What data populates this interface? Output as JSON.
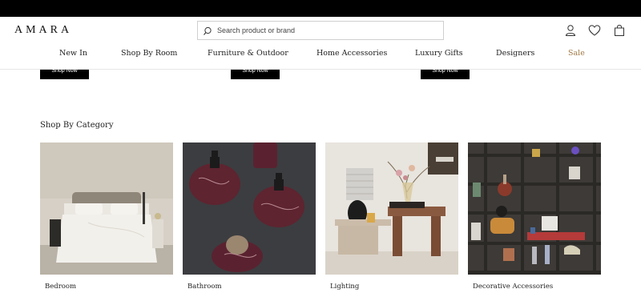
{
  "brand": {
    "name": "AMARA"
  },
  "search": {
    "placeholder": "Search product or brand"
  },
  "nav": {
    "items": [
      {
        "label": "New In"
      },
      {
        "label": "Shop By Room"
      },
      {
        "label": "Furniture & Outdoor"
      },
      {
        "label": "Home Accessories"
      },
      {
        "label": "Luxury Gifts"
      },
      {
        "label": "Designers"
      },
      {
        "label": "Sale"
      }
    ]
  },
  "promo": {
    "buttons": [
      {
        "label": "Shop Now"
      },
      {
        "label": "Shop Now"
      },
      {
        "label": "Shop Now"
      }
    ]
  },
  "category_section": {
    "title": "Shop By Category",
    "cards": [
      {
        "label": "Bedroom"
      },
      {
        "label": "Bathroom"
      },
      {
        "label": "Lighting"
      },
      {
        "label": "Decorative Accessories"
      }
    ]
  },
  "icons": {
    "account": "account-icon",
    "wishlist": "heart-icon",
    "bag": "shopping-bag-icon",
    "search": "search-icon"
  },
  "colors": {
    "top_bar": "#000000",
    "sale": "#a07a45",
    "button_bg": "#000000"
  }
}
